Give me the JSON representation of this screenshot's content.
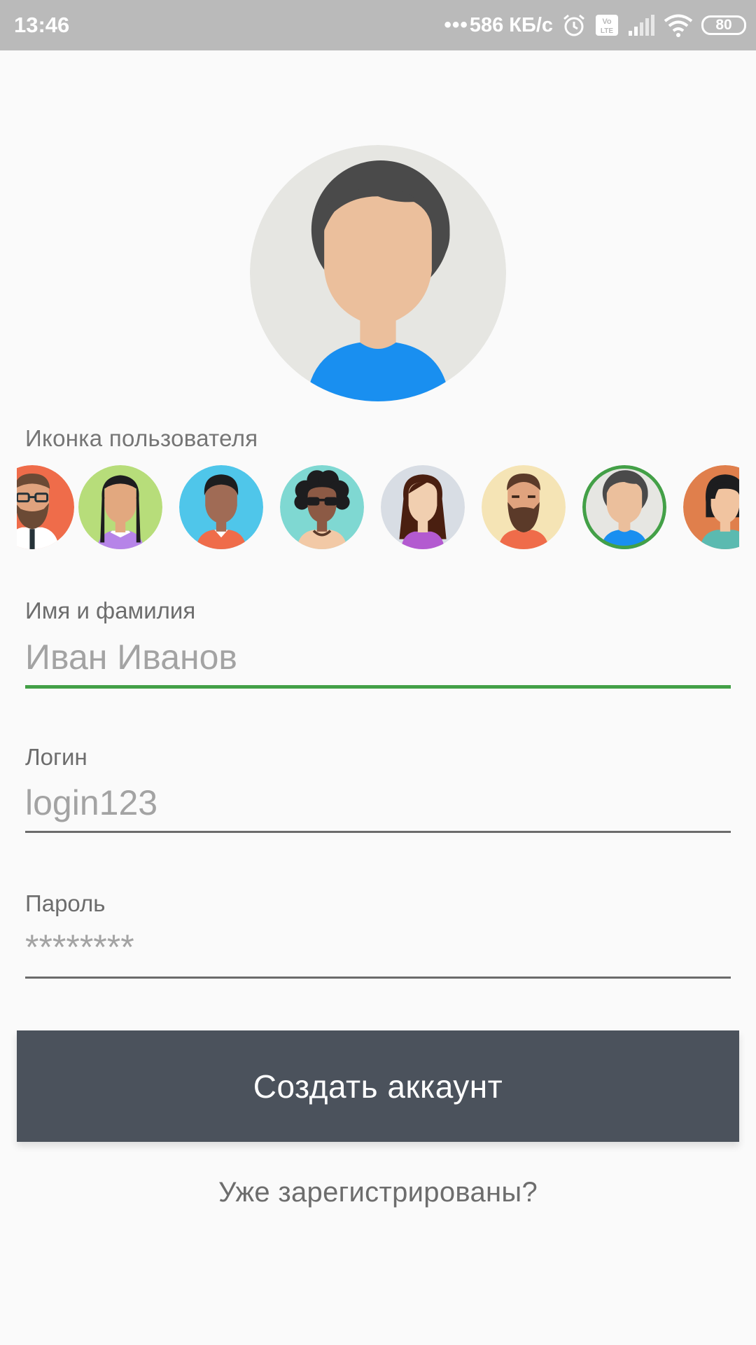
{
  "status_bar": {
    "time": "13:46",
    "network_speed": "586 КБ/с",
    "battery_level": "80",
    "icons": [
      "more-dots-icon",
      "alarm-icon",
      "volte-icon",
      "signal-icon",
      "wifi-icon",
      "battery-icon"
    ]
  },
  "profile": {
    "avatar_label": "Иконка пользователя",
    "selected_avatar_index": 6,
    "avatars": [
      {
        "name": "avatar-bearded-glasses",
        "bg": "#ef6c4a"
      },
      {
        "name": "avatar-girl-braids",
        "bg": "#b7dd7a"
      },
      {
        "name": "avatar-dark-man",
        "bg": "#4fc6ea"
      },
      {
        "name": "avatar-curly-sunglasses",
        "bg": "#7fd8d2"
      },
      {
        "name": "avatar-long-hair-woman",
        "bg": "#d8dde4"
      },
      {
        "name": "avatar-bearded-man",
        "bg": "#f5e4b5"
      },
      {
        "name": "avatar-default-selected",
        "bg": "#e6e6e2"
      },
      {
        "name": "avatar-black-bob",
        "bg": "#e07f4c"
      }
    ]
  },
  "form": {
    "fullname": {
      "label": "Имя и фамилия",
      "placeholder": "Иван Иванов",
      "value": ""
    },
    "login": {
      "label": "Логин",
      "placeholder": "login123",
      "value": ""
    },
    "password": {
      "label": "Пароль",
      "placeholder": "********",
      "value": ""
    },
    "submit_label": "Создать аккаунт",
    "already_registered_label": "Уже зарегистрированы?"
  },
  "colors": {
    "accent": "#43a047",
    "button_bg": "#4b525c",
    "status_bar_bg": "#bababa",
    "background": "#fafafa"
  }
}
